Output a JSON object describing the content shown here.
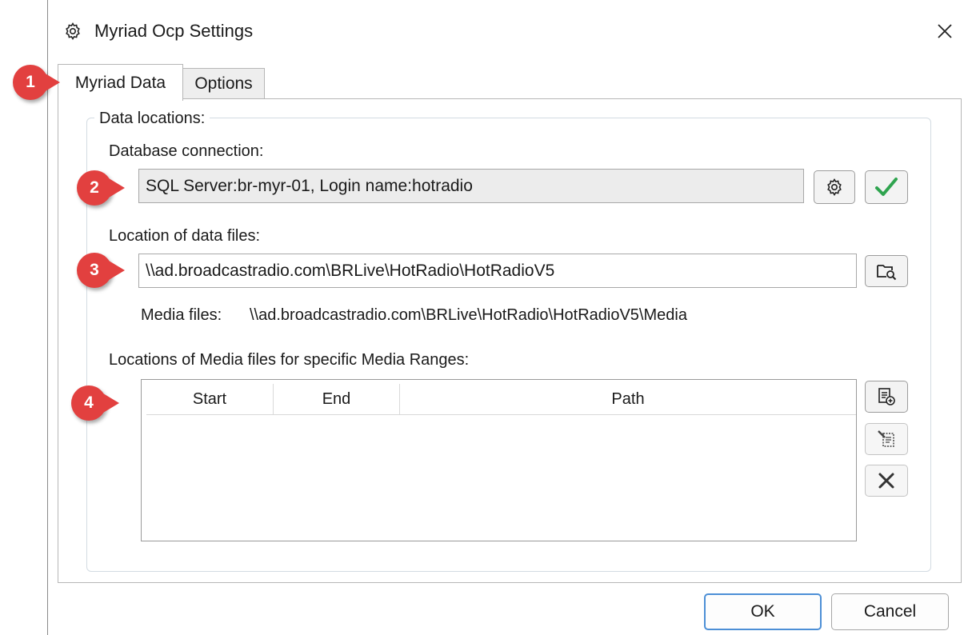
{
  "window": {
    "title": "Myriad Ocp Settings",
    "title_icon": "gear-icon",
    "close_icon": "close-icon"
  },
  "tabs": [
    {
      "label": "Myriad Data",
      "active": true
    },
    {
      "label": "Options",
      "active": false
    }
  ],
  "data_locations": {
    "legend": "Data locations:",
    "database_connection": {
      "label": "Database connection:",
      "value": "SQL Server:br-myr-01, Login name:hotradio",
      "settings_icon": "gear-icon",
      "test_icon": "check-icon"
    },
    "data_files": {
      "label": "Location of data files:",
      "value": "\\\\ad.broadcastradio.com\\BRLive\\HotRadio\\HotRadioV5",
      "browse_icon": "folder-search-icon"
    },
    "media_files": {
      "label": "Media files:",
      "value": "\\\\ad.broadcastradio.com\\BRLive\\HotRadio\\HotRadioV5\\Media"
    },
    "media_ranges": {
      "label": "Locations of Media files for specific Media Ranges:",
      "columns": [
        "Start",
        "End",
        "Path"
      ],
      "rows": [],
      "add_icon": "add-range-icon",
      "edit_icon": "edit-range-icon",
      "delete_icon": "delete-icon"
    }
  },
  "markers": [
    "1",
    "2",
    "3",
    "4"
  ],
  "footer": {
    "ok_label": "OK",
    "cancel_label": "Cancel"
  },
  "colors": {
    "marker": "#e2403f",
    "check": "#2fa44f",
    "focus_border": "#4c8fd6"
  }
}
